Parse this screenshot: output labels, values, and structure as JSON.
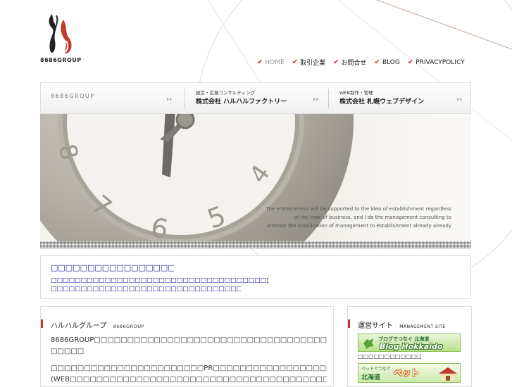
{
  "logo": {
    "text": "8686GROUP"
  },
  "nav": {
    "items": [
      {
        "label": "HOME",
        "active": true
      },
      {
        "label": "取引企業",
        "active": false
      },
      {
        "label": "お問合せ",
        "active": false
      },
      {
        "label": "BLOG",
        "active": false
      },
      {
        "label": "PRIVACYPOLICY",
        "active": false
      }
    ]
  },
  "tabs": {
    "group": {
      "label": "8686GROUP"
    },
    "factory": {
      "small": "経営・広報コンサルティング",
      "big": "株式会社 ハルハルファクトリー"
    },
    "web": {
      "small": "WEB制作・管理",
      "big": "株式会社 札幌ウェブデザイン"
    },
    "arrow": "››"
  },
  "hero": {
    "caption": [
      "The entrepreneur will be supported to the idea of establishment regardless",
      "of the type of business, and I do the management consulting to",
      "attempt the stabilization of management to establishment already already"
    ],
    "dial_numbers": [
      "8",
      "7",
      "6",
      "5",
      "4"
    ]
  },
  "notice": {
    "title": "□□□□□□□□□□□□□□□□□□□□□□□□□",
    "line1": "□□□□□□□□□□□□□□□□□□□□□□□□□□□□□□□□□□□□□□□□□□□□□□□□□",
    "line2": "□□□□□□□□□□□□□□□□□□□□□□□□□□□□□□□□□□□□□□□□□□□□"
  },
  "about": {
    "title": "ハルハルグループ",
    "subtitle": "8686GROUP",
    "p1_line1": "8686GROUP□□□□□□□□□□□□□□□□□□□□□□□□□□□□□□□□□□□□□□□□□□2□□□□□□□□□□",
    "p1_line2": "□□□□□",
    "p2_line1": "□□□□□□□□□□□□□□□□□□□□□□□PR□□□□□□□□□□□□□□□□□□□□□□□□□□□□□□□□□□□",
    "p2_line2": "(WEB□□□□□□□□□□□□□□□□□□□□□□□□□□□□□□□□□□□□□□□□□□□□□□□□□□□□□"
  },
  "side": {
    "title": "運営サイト",
    "subtitle": "MANAGEMENT SITE",
    "banner1": {
      "top": "ブログでつなぐ 北海道",
      "main": "Blog Hokkaido"
    },
    "banner1_caption": "□□□□□□□□□□□□",
    "banner2": {
      "top": "ペットでつなぐ",
      "region": "北海道",
      "main": "ペット"
    }
  },
  "colors": {
    "accent": "#c0392b",
    "link": "#1a1aa6",
    "banner_green": "#8dbf52"
  }
}
